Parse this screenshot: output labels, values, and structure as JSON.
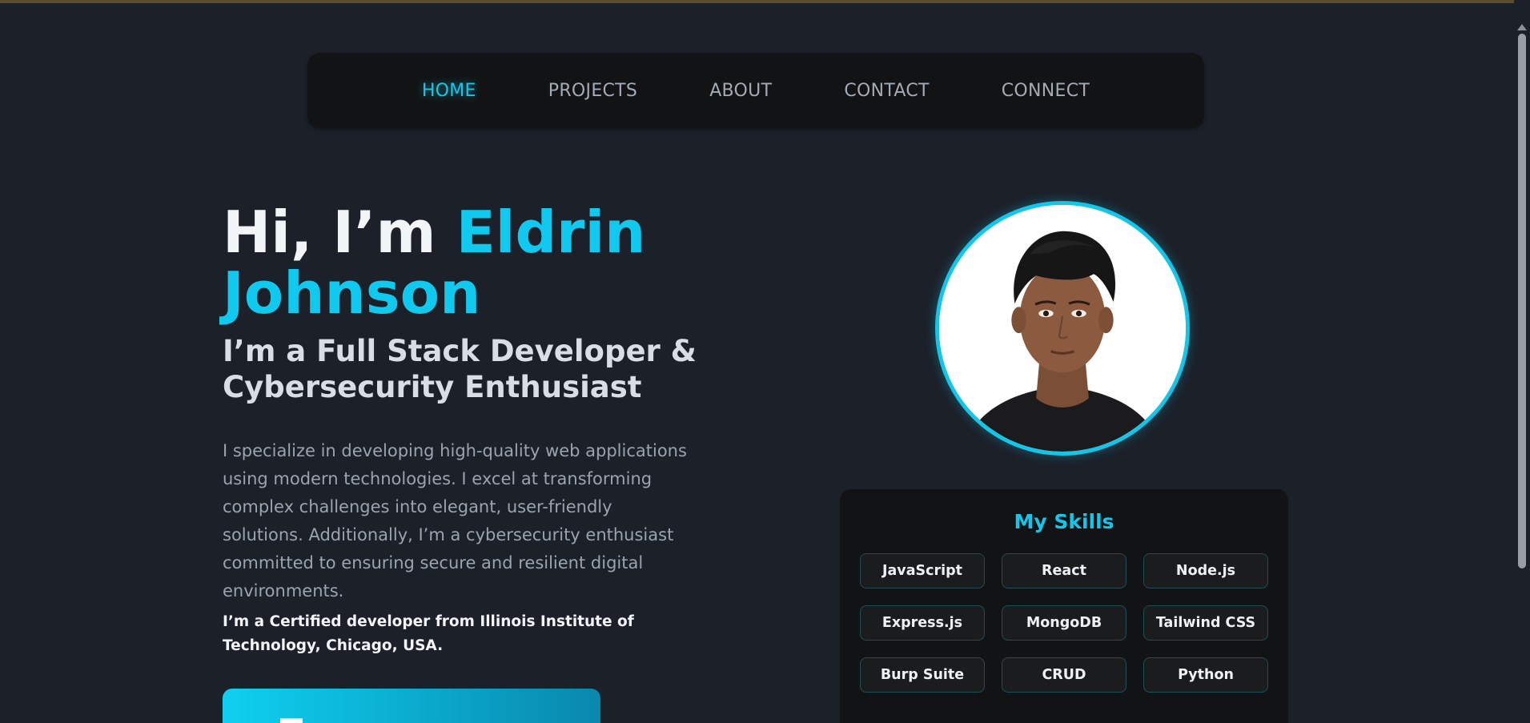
{
  "nav": {
    "items": [
      {
        "label": "HOME",
        "active": true
      },
      {
        "label": "PROJECTS",
        "active": false
      },
      {
        "label": "ABOUT",
        "active": false
      },
      {
        "label": "CONTACT",
        "active": false
      },
      {
        "label": "CONNECT",
        "active": false
      }
    ]
  },
  "hero": {
    "greeting": "Hi, I’m ",
    "name": "Eldrin Johnson",
    "subtitle": "I’m a Full Stack Developer & Cybersecurity Enthusiast",
    "description": "I specialize in developing high-quality web applications using modern technologies. I excel at transforming complex challenges into elegant, user-friendly solutions. Additionally, I’m a cybersecurity enthusiast committed to ensuring secure and resilient digital environments.",
    "certification": "I’m a Certified developer from Illinois Institute of Technology, Chicago, USA."
  },
  "skills": {
    "title": "My Skills",
    "items": [
      "JavaScript",
      "React",
      "Node.js",
      "Express.js",
      "MongoDB",
      "Tailwind CSS",
      "Burp Suite",
      "CRUD",
      "Python"
    ]
  },
  "colors": {
    "accent": "#10c9ee",
    "background": "#1c2029",
    "card": "#121314"
  }
}
